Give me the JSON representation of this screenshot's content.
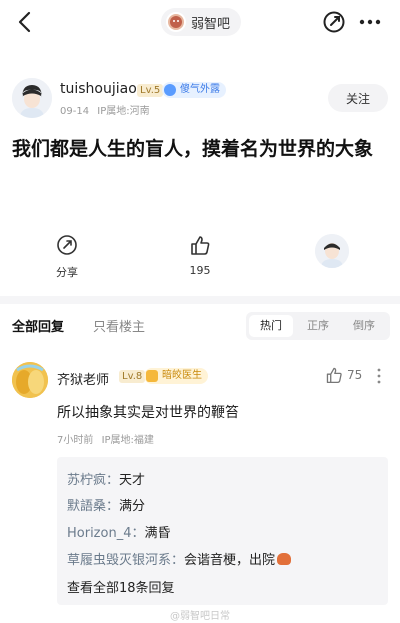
{
  "nav": {
    "forum_name": "弱智吧",
    "back_icon": "chevron-left-icon",
    "share_icon": "share-icon",
    "more_icon": "more-horizontal-icon"
  },
  "post": {
    "author": "tuishoujiao",
    "level": "Lv.5",
    "badge": "傻气外露",
    "date": "09-14",
    "ip": "IP属地:河南",
    "follow_label": "关注",
    "title": "我们都是人生的盲人，摸着名为世界的大象",
    "share_label": "分享",
    "like_count": "195"
  },
  "filters": {
    "all_label": "全部回复",
    "op_only_label": "只看楼主",
    "sort_hot": "热门",
    "sort_asc": "正序",
    "sort_desc": "倒序"
  },
  "comment": {
    "author": "齐狱老师",
    "level": "Lv.8",
    "badge": "暗皎医生",
    "likes": "75",
    "text": "所以抽象其实是对世界的鞭笞",
    "time": "7小时前",
    "ip": "IP属地:福建",
    "replies": [
      {
        "who": "苏柠疯：",
        "text": "天才"
      },
      {
        "who": "默語桑：",
        "text": "满分"
      },
      {
        "who": "Horizon_4：",
        "text": "满昏"
      },
      {
        "who": "草履虫毁灭银河系：",
        "text": "会谐音梗，出院"
      }
    ],
    "view_all": "查看全部18条回复"
  },
  "watermark": "@弱智吧日常",
  "colors": {
    "accent_blue": "#3c7be8",
    "level_gold": "#a07a2a",
    "badge_orange": "#c98a0c"
  }
}
